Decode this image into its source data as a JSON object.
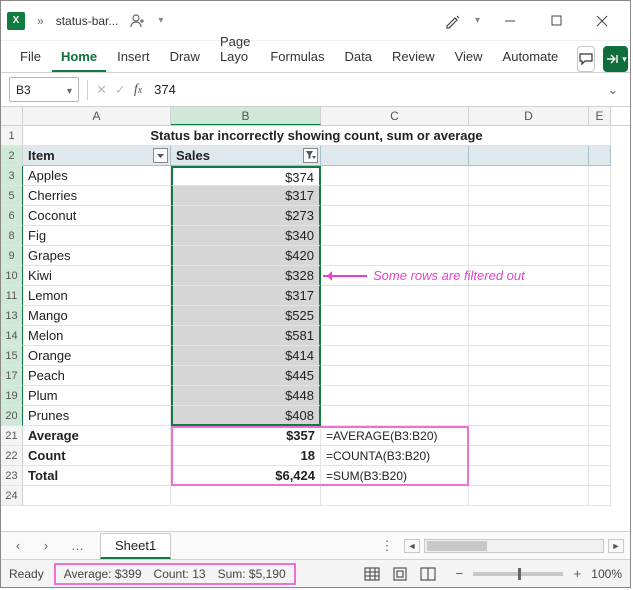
{
  "title": {
    "doc": "status-bar..."
  },
  "ribbon": {
    "tabs": [
      "File",
      "Home",
      "Insert",
      "Draw",
      "Page Layo",
      "Formulas",
      "Data",
      "Review",
      "View",
      "Automate"
    ],
    "active": 1
  },
  "fbar": {
    "name": "B3",
    "formula": "374"
  },
  "columns": [
    "A",
    "B",
    "C",
    "D",
    "E"
  ],
  "sheet_title": "Status bar incorrectly showing count, sum or average",
  "headers": {
    "a": "Item",
    "b": "Sales"
  },
  "rows": [
    {
      "n": "3",
      "item": "Apples",
      "sales": "$374"
    },
    {
      "n": "5",
      "item": "Cherries",
      "sales": "$317"
    },
    {
      "n": "6",
      "item": "Coconut",
      "sales": "$273"
    },
    {
      "n": "8",
      "item": "Fig",
      "sales": "$340"
    },
    {
      "n": "9",
      "item": "Grapes",
      "sales": "$420"
    },
    {
      "n": "10",
      "item": "Kiwi",
      "sales": "$328"
    },
    {
      "n": "11",
      "item": "Lemon",
      "sales": "$317"
    },
    {
      "n": "13",
      "item": "Mango",
      "sales": "$525"
    },
    {
      "n": "14",
      "item": "Melon",
      "sales": "$581"
    },
    {
      "n": "15",
      "item": "Orange",
      "sales": "$414"
    },
    {
      "n": "17",
      "item": "Peach",
      "sales": "$445"
    },
    {
      "n": "19",
      "item": "Plum",
      "sales": "$448"
    },
    {
      "n": "20",
      "item": "Prunes",
      "sales": "$408"
    }
  ],
  "summary": [
    {
      "n": "21",
      "label": "Average",
      "value": "$357",
      "formula": "=AVERAGE(B3:B20)"
    },
    {
      "n": "22",
      "label": "Count",
      "value": "18",
      "formula": "=COUNTA(B3:B20)"
    },
    {
      "n": "23",
      "label": "Total",
      "value": "$6,424",
      "formula": "=SUM(B3:B20)"
    }
  ],
  "extra_row": "24",
  "anno": "Some rows are filtered out",
  "sheet_tab": "Sheet1",
  "status": {
    "ready": "Ready",
    "avg": "Average: $399",
    "count": "Count: 13",
    "sum": "Sum: $5,190",
    "zoom": "100%"
  }
}
